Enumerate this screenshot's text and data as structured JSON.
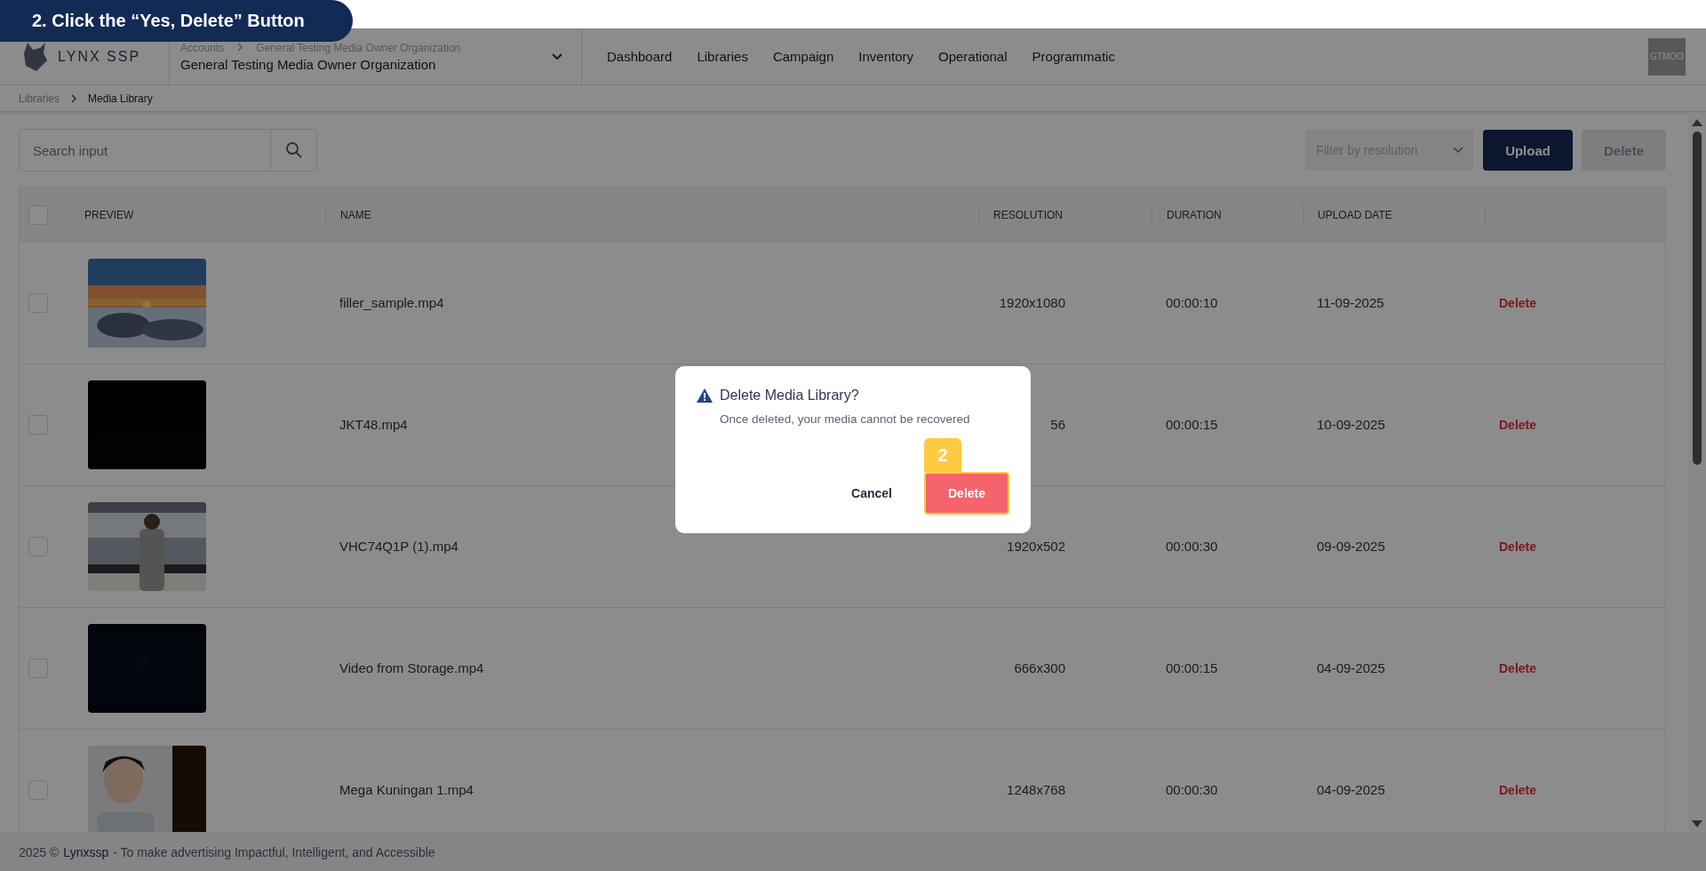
{
  "tutorial_banner": {
    "text": "2. Click the “Yes, Delete” Button"
  },
  "header": {
    "logo_text": "LYNX SSP",
    "account": {
      "breadcrumb": [
        "Accounts",
        "General Testing Media Owner Organization"
      ],
      "name": "General Testing Media Owner Organization"
    },
    "nav": [
      {
        "label": "Dashboard",
        "selected": false
      },
      {
        "label": "Libraries",
        "selected": false
      },
      {
        "label": "Campaign",
        "selected": false
      },
      {
        "label": "Inventory",
        "selected": false
      },
      {
        "label": "Operational",
        "selected": false
      },
      {
        "label": "Programmatic",
        "selected": false
      }
    ],
    "avatar": "GTMOO"
  },
  "breadcrumb": [
    "Libraries",
    "Media Library"
  ],
  "toolbar": {
    "search": {
      "placeholder": "Search input"
    },
    "filter": {
      "placeholder": "Filter by resolution"
    },
    "upload": {
      "label": "Upload",
      "disabled": false
    },
    "delete": {
      "label": "Delete",
      "disabled": true
    }
  },
  "table": {
    "select_all": {
      "checked": false
    },
    "columns": [
      "PREVIEW",
      "NAME",
      "RESOLUTION",
      "DURATION",
      "UPLOAD DATE"
    ],
    "rows": [
      {
        "checked": false,
        "name": "filler_sample.mp4",
        "resolution": "1920x1080",
        "duration": "00:00:10",
        "upload_date": "11-09-2025",
        "action": "Delete"
      },
      {
        "checked": false,
        "name": "JKT48.mp4",
        "resolution": "56",
        "duration": "00:00:15",
        "upload_date": "10-09-2025",
        "action": "Delete"
      },
      {
        "checked": false,
        "name": "VHC74Q1P (1).mp4",
        "resolution": "1920x502",
        "duration": "00:00:30",
        "upload_date": "09-09-2025",
        "action": "Delete"
      },
      {
        "checked": false,
        "name": "Video from Storage.mp4",
        "resolution": "666x300",
        "duration": "00:00:15",
        "upload_date": "04-09-2025",
        "action": "Delete"
      },
      {
        "checked": false,
        "name": "Mega Kuningan 1.mp4",
        "resolution": "1248x768",
        "duration": "00:00:30",
        "upload_date": "04-09-2025",
        "action": "Delete"
      }
    ]
  },
  "footer": {
    "year": "2025 ©",
    "brand": "Lynxssp",
    "tagline": "- To make advertising Impactful, Intelligent, and Accessible"
  },
  "dialog": {
    "title": "Delete Media Library?",
    "message": "Once deleted, your media cannot be recovered",
    "cancel": "Cancel",
    "confirm": "Delete",
    "confirm_highlighted": true,
    "step_badge": "2"
  }
}
